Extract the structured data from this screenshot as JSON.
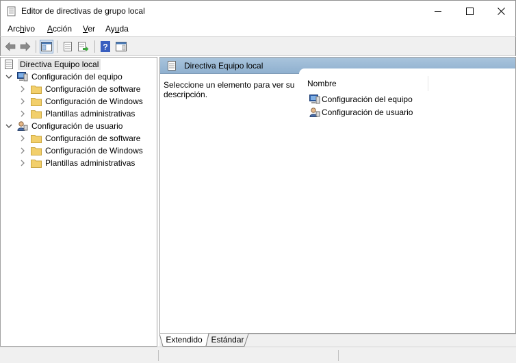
{
  "window": {
    "title": "Editor de directivas de grupo local"
  },
  "menu": {
    "items": [
      {
        "pre": "Arc",
        "u": "h",
        "post": "ivo"
      },
      {
        "pre": "",
        "u": "A",
        "post": "cción"
      },
      {
        "pre": "",
        "u": "V",
        "post": "er"
      },
      {
        "pre": "Ay",
        "u": "u",
        "post": "da"
      }
    ]
  },
  "toolbar": {
    "buttons": [
      "back-icon",
      "forward-icon",
      "show-hide-tree-icon",
      "properties-icon",
      "export-list-icon",
      "help-icon",
      "show-action-pane-icon"
    ]
  },
  "tree": {
    "root": "Directiva Equipo local",
    "computer": {
      "label": "Configuración del equipo",
      "children": [
        "Configuración de software",
        "Configuración de Windows",
        "Plantillas administrativas"
      ]
    },
    "user": {
      "label": "Configuración de usuario",
      "children": [
        "Configuración de software",
        "Configuración de Windows",
        "Plantillas administrativas"
      ]
    }
  },
  "details": {
    "header_title": "Directiva Equipo local",
    "description": "Seleccione un elemento para ver su descripción.",
    "column_name": "Nombre",
    "items": [
      "Configuración del equipo",
      "Configuración de usuario"
    ]
  },
  "tabs": {
    "extended": "Extendido",
    "standard": "Estándar"
  },
  "colors": {
    "header_gradient_top": "#a9c4dc",
    "header_gradient_bottom": "#8fb0cf",
    "selection": "#e5e5e5",
    "folder": "#f2cf6b"
  }
}
